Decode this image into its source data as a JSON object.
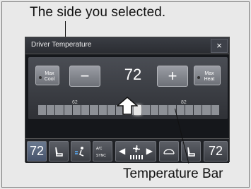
{
  "callouts": {
    "top": "The side you selected.",
    "bottom": "Temperature Bar"
  },
  "dialog": {
    "title": "Driver Temperature",
    "close_label": "×",
    "max_cool_label": "Max\nCool",
    "minus_label": "−",
    "temperature": "72",
    "plus_label": "+",
    "max_heat_label": "Max\nHeat",
    "bar_labels": [
      "62",
      "72",
      "82"
    ],
    "bar_level_index": 11,
    "bar_segment_count": 21
  },
  "bottom_bar": {
    "driver_temp": "72",
    "passenger_temp": "72",
    "ac_label": "A/C",
    "sync_label": "SYNC"
  },
  "colors": {
    "screen_bg": "#15171b",
    "button": "#8b8e95",
    "highlight": "#ffffff"
  }
}
